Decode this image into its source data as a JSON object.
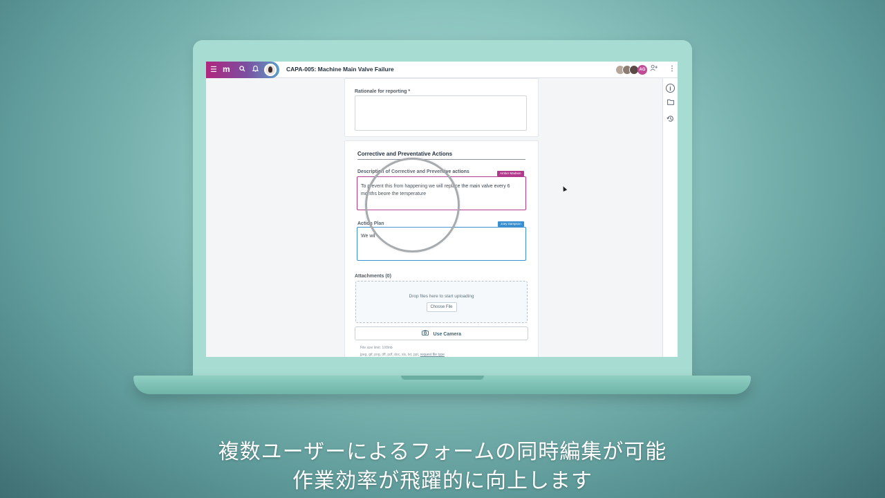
{
  "app": {
    "title": "CAPA-005: Machine Main Valve Failure",
    "collaborator_initials": "AG",
    "colors": {
      "brand_magenta": "#b0267e",
      "brand_blue": "#5b9ec7",
      "editor_amber": "#b23a8c",
      "editor_joey": "#3a8fd0"
    },
    "icons": {
      "menu": "menu-icon",
      "logo": "logo-icon",
      "search": "search-icon",
      "notifications": "bell-icon",
      "add_user": "add-user-icon",
      "more": "more-vertical-icon",
      "info": "info-icon",
      "folder": "folder-icon",
      "history": "history-icon",
      "camera": "camera-icon"
    }
  },
  "form": {
    "rationale": {
      "label": "Rationale for reporting *",
      "value": ""
    },
    "capa_section": {
      "title": "Corrective and Preventative Actions",
      "description": {
        "label": "Description of Corrective and Preventive actions",
        "editor_tag": "Amber Madsen",
        "value": "To prevent this from happening we will replace the main valve every 6 months beore the temperature"
      },
      "action_plan": {
        "label": "Action Plan",
        "editor_tag": "Joey Sampson",
        "value": "We wil"
      }
    },
    "attachments": {
      "label": "Attachments (0)",
      "drop_text": "Drop files here to start uploading",
      "choose_file": "Choose File",
      "use_camera": "Use Camera",
      "size_limit": "File size limit: 100mb",
      "file_types": "jpeg, gif, png, tiff, pdf, doc, xls, txt, ppt,",
      "request_link": "request file type"
    }
  },
  "subtitles": {
    "line1": "複数ユーザーによるフォームの同時編集が可能",
    "line2": "作業効率が飛躍的に向上します"
  }
}
